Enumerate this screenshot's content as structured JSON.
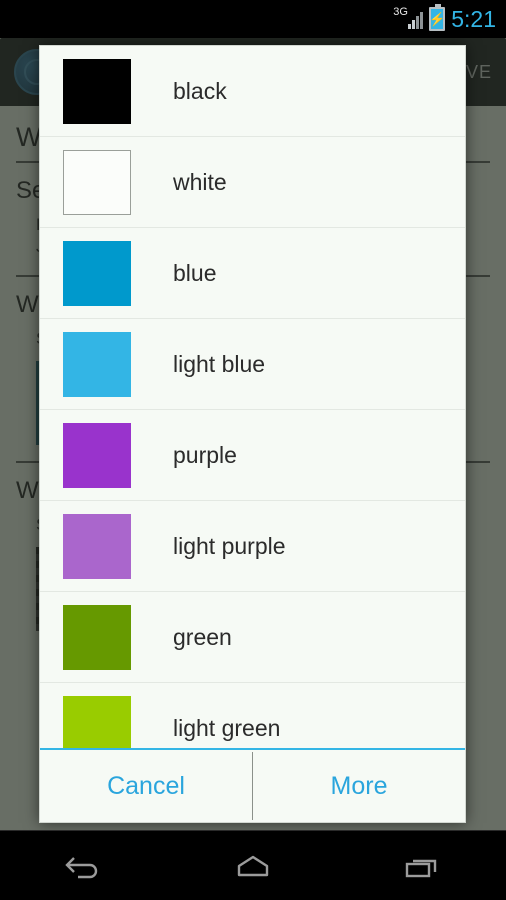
{
  "status_bar": {
    "network_label": "3G",
    "network_icon": "signal-bars-icon",
    "battery_icon": "battery-charging-icon",
    "battery_bolt": "⚡",
    "time": "5:21"
  },
  "background_app": {
    "logo_icon": "app-logo-icon",
    "save_label": "VE",
    "heading_1": "W",
    "section_1": "Se",
    "line_1": "Da",
    "line_2": "Ju",
    "heading_2": "Wi",
    "sub_2": "Se",
    "heading_3": "Wi",
    "sub_3": "Se"
  },
  "dialog": {
    "colors": [
      {
        "name": "black",
        "hex": "#000000",
        "bordered": false
      },
      {
        "name": "white",
        "hex": "#fbfdfa",
        "bordered": true
      },
      {
        "name": "blue",
        "hex": "#0099cc",
        "bordered": false
      },
      {
        "name": "light blue",
        "hex": "#33b5e5",
        "bordered": false
      },
      {
        "name": "purple",
        "hex": "#9933cc",
        "bordered": false
      },
      {
        "name": "light purple",
        "hex": "#aa66cc",
        "bordered": false
      },
      {
        "name": "green",
        "hex": "#669900",
        "bordered": false
      },
      {
        "name": "light green",
        "hex": "#99cc00",
        "bordered": false
      }
    ],
    "cancel_label": "Cancel",
    "more_label": "More",
    "accent_color": "#33b5e5"
  },
  "nav_bar": {
    "back_icon": "back-icon",
    "home_icon": "home-icon",
    "recents_icon": "recent-apps-icon"
  }
}
